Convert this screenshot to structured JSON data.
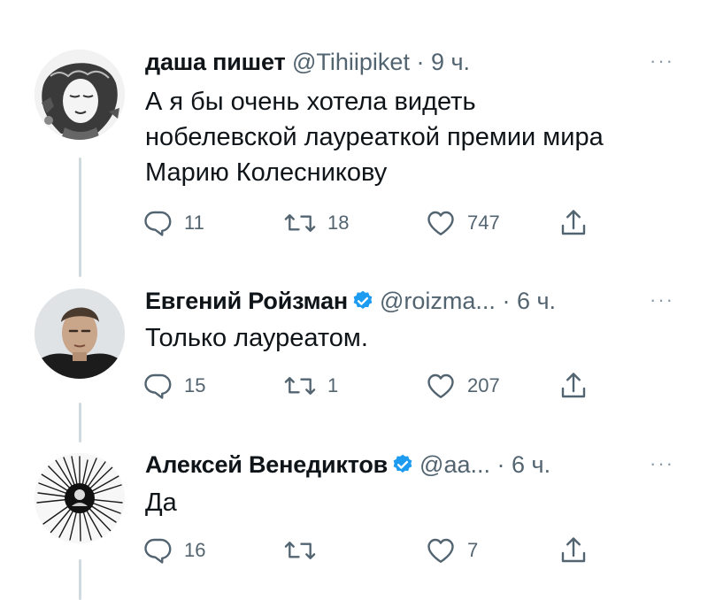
{
  "tweets": [
    {
      "name": "даша пишет",
      "handle": "@Tihiipiket",
      "time": "· 9 ч.",
      "verified": false,
      "avatar": "illustrated-woman-portrait",
      "text_lines": [
        "А я бы очень хотела видеть",
        "нобелевской лауреаткой премии мира",
        "Марию Колесникову"
      ],
      "replies": "11",
      "retweets": "18",
      "likes": "747"
    },
    {
      "name": "Евгений Ройзман",
      "handle": "@roizma...",
      "time": "· 6 ч.",
      "verified": true,
      "avatar": "man-photo",
      "text_lines": [
        "Только лауреатом."
      ],
      "replies": "15",
      "retweets": "1",
      "likes": "207"
    },
    {
      "name": "Алексей Венедиктов",
      "handle": "@aa...",
      "time": "· 6 ч.",
      "verified": true,
      "avatar": "ink-burst-figure",
      "text_lines": [
        "Да"
      ],
      "replies": "16",
      "retweets": "",
      "likes": "7"
    }
  ],
  "more_label": "···",
  "colors": {
    "text": "#0f1419",
    "secondary": "#536471",
    "verified": "#1d9bf0",
    "thread_line": "#cfd9de"
  },
  "icons": [
    "reply-icon",
    "retweet-icon",
    "like-icon",
    "share-icon",
    "verified-icon",
    "more-icon"
  ]
}
